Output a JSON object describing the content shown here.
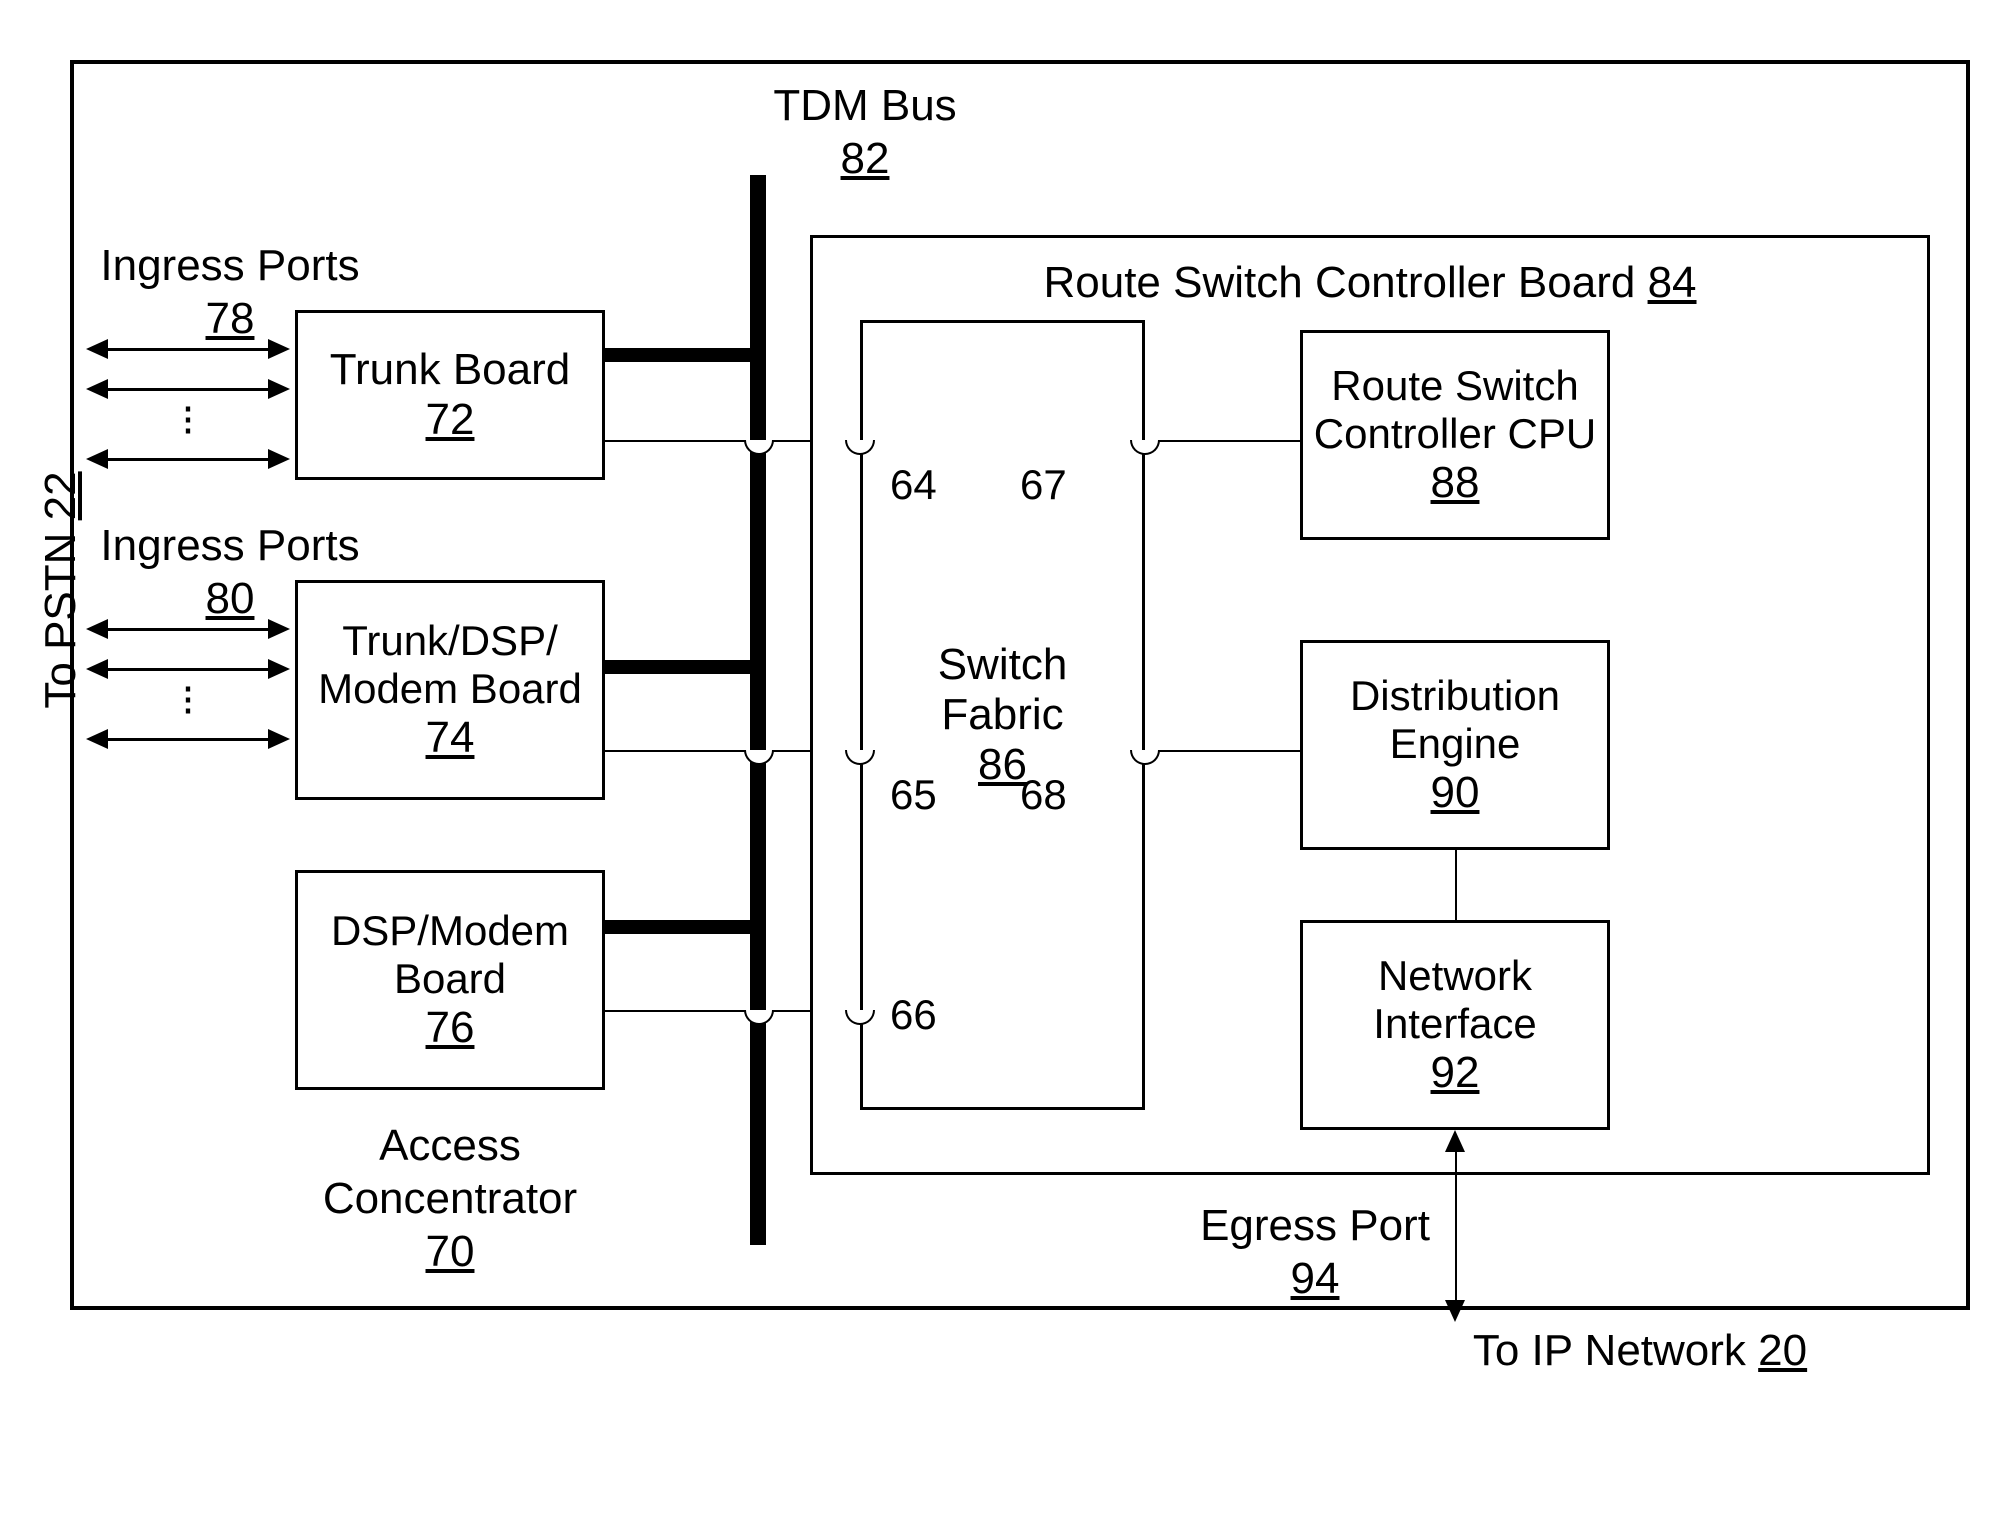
{
  "external": {
    "pstn_label": "To PSTN",
    "pstn_ref": "22",
    "ip_label": "To IP Network",
    "ip_ref": "20"
  },
  "bus": {
    "label": "TDM Bus",
    "ref": "82"
  },
  "ingress1": {
    "label": "Ingress Ports",
    "ref": "78"
  },
  "ingress2": {
    "label": "Ingress Ports",
    "ref": "80"
  },
  "trunk": {
    "label": "Trunk Board",
    "ref": "72"
  },
  "trunk_dsp": {
    "label1": "Trunk/DSP/",
    "label2": "Modem Board",
    "ref": "74"
  },
  "dsp_modem": {
    "label1": "DSP/Modem",
    "label2": "Board",
    "ref": "76"
  },
  "access": {
    "label1": "Access",
    "label2": "Concentrator",
    "ref": "70"
  },
  "rsc_board": {
    "label": "Route Switch Controller Board",
    "ref": "84"
  },
  "switch_fabric": {
    "label1": "Switch",
    "label2": "Fabric",
    "ref": "86"
  },
  "rsc_cpu": {
    "label1": "Route Switch",
    "label2": "Controller CPU",
    "ref": "88"
  },
  "dist": {
    "label1": "Distribution",
    "label2": "Engine",
    "ref": "90"
  },
  "netif": {
    "label1": "Network",
    "label2": "Interface",
    "ref": "92"
  },
  "egress": {
    "label": "Egress Port",
    "ref": "94"
  },
  "ports": {
    "p64": "64",
    "p65": "65",
    "p66": "66",
    "p67": "67",
    "p68": "68"
  }
}
